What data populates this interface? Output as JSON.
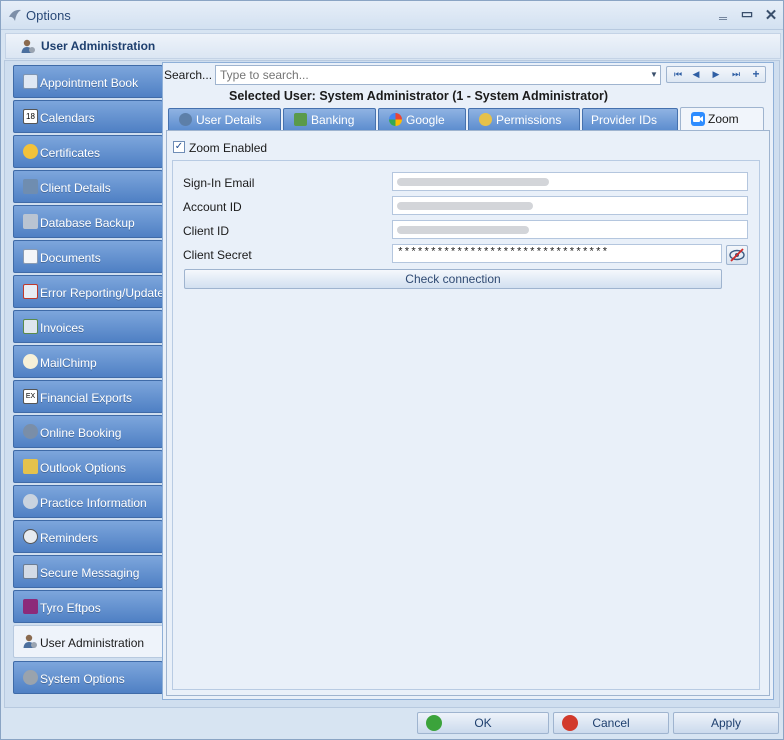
{
  "window": {
    "title": "Options"
  },
  "header": {
    "label": "User Administration"
  },
  "sidebar": {
    "items": [
      {
        "label": "Appointment Book",
        "icon": "calendar-book-icon"
      },
      {
        "label": "Calendars",
        "icon": "calendar-icon"
      },
      {
        "label": "Certificates",
        "icon": "certificate-icon"
      },
      {
        "label": "Client Details",
        "icon": "clients-icon"
      },
      {
        "label": "Database Backup",
        "icon": "database-icon"
      },
      {
        "label": "Documents",
        "icon": "document-icon"
      },
      {
        "label": "Error Reporting/Updates",
        "icon": "error-report-icon"
      },
      {
        "label": "Invoices",
        "icon": "invoice-icon"
      },
      {
        "label": "MailChimp",
        "icon": "mailchimp-icon"
      },
      {
        "label": "Financial Exports",
        "icon": "export-icon"
      },
      {
        "label": "Online Booking",
        "icon": "online-booking-icon"
      },
      {
        "label": "Outlook Options",
        "icon": "outlook-icon"
      },
      {
        "label": "Practice Information",
        "icon": "practice-icon"
      },
      {
        "label": "Reminders",
        "icon": "reminder-icon"
      },
      {
        "label": "Secure Messaging",
        "icon": "secure-message-icon"
      },
      {
        "label": "Tyro Eftpos",
        "icon": "tyro-icon"
      },
      {
        "label": "User Administration",
        "icon": "user-admin-icon",
        "active": true
      },
      {
        "label": "System Options",
        "icon": "system-options-icon"
      }
    ]
  },
  "search": {
    "label": "Search...",
    "placeholder": "Type to search..."
  },
  "selected_user": "Selected User: System Administrator (1 - System Administrator)",
  "tabs": [
    {
      "label": "User Details",
      "icon": "user-icon"
    },
    {
      "label": "Banking",
      "icon": "bank-icon"
    },
    {
      "label": "Google",
      "icon": "google-icon"
    },
    {
      "label": "Permissions",
      "icon": "permissions-icon"
    },
    {
      "label": "Provider IDs",
      "icon": ""
    },
    {
      "label": "Zoom",
      "icon": "zoom-icon",
      "active": true
    }
  ],
  "zoom": {
    "enabled_label": "Zoom Enabled",
    "enabled": true,
    "fields": {
      "signin_email": {
        "label": "Sign-In Email"
      },
      "account_id": {
        "label": "Account ID"
      },
      "client_id": {
        "label": "Client ID"
      },
      "client_secret": {
        "label": "Client Secret",
        "value": "********************************"
      }
    },
    "check_button": "Check connection"
  },
  "buttons": {
    "ok": "OK",
    "cancel": "Cancel",
    "apply": "Apply"
  },
  "colors": {
    "sidebar": "#5b8bcf",
    "accent": "#2f5fa4",
    "window_bg": "#d7e4f2"
  }
}
